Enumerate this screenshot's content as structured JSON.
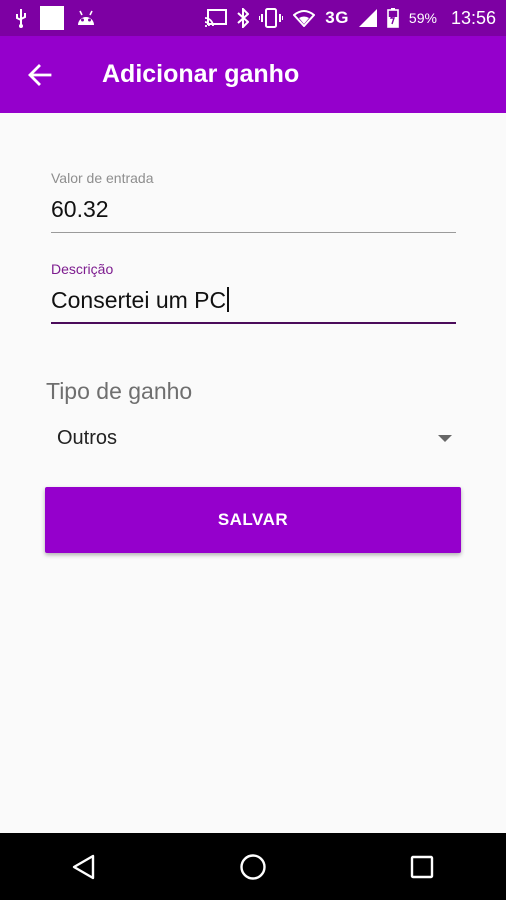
{
  "status_bar": {
    "network": "3G",
    "battery": "59%",
    "time": "13:56",
    "icons_left": [
      "usb-icon",
      "notification-square-icon",
      "android-icon"
    ],
    "icons_right": [
      "cast-icon",
      "bluetooth-icon",
      "vibrate-icon",
      "wifi-icon",
      "signal-icon",
      "battery-charging-icon"
    ]
  },
  "app_bar": {
    "title": "Adicionar ganho",
    "back_icon": "arrow-back-icon"
  },
  "form": {
    "valor": {
      "label": "Valor de entrada",
      "value": "60.32"
    },
    "descricao": {
      "label": "Descrição",
      "value": "Consertei um PC"
    },
    "tipo": {
      "label": "Tipo de ganho",
      "selected": "Outros"
    },
    "save_label": "SALVAR"
  },
  "nav_bar": {
    "buttons": [
      "back-triangle-icon",
      "home-circle-icon",
      "recents-square-icon"
    ]
  },
  "colors": {
    "status_bar": "#7d00a3",
    "primary": "#9500cc",
    "focus_label": "#7d1c8f",
    "background": "#fafafa"
  }
}
